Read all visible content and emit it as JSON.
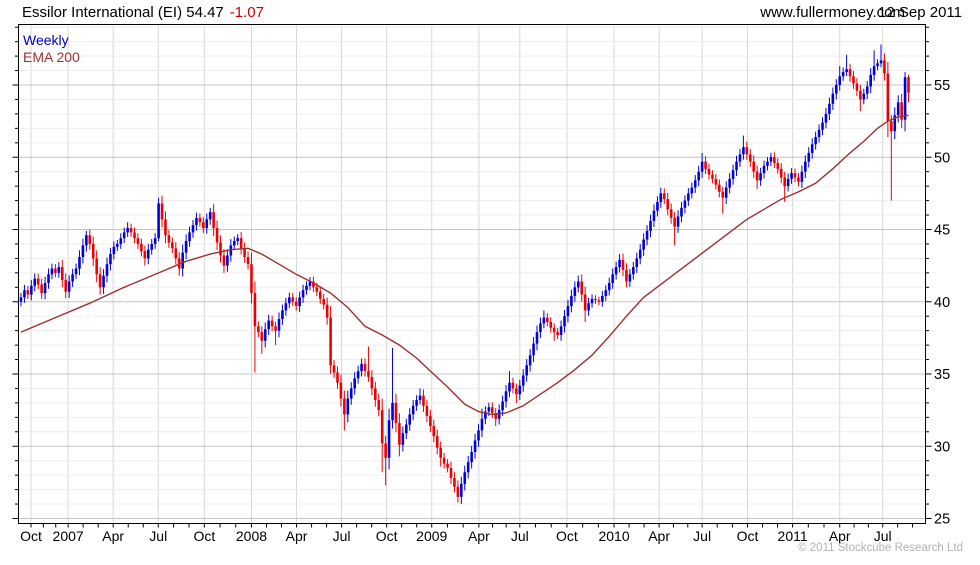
{
  "header": {
    "title_main": "Essilor International (EI) 54.47",
    "change": "-1.07",
    "site": "www.fullermoney.com",
    "date": "12 Sep 2011"
  },
  "legend": {
    "timeframe": "Weekly",
    "overlay": "EMA 200"
  },
  "footer": {
    "copyright": "© 2011 Stockcube Research Ltd"
  },
  "colors": {
    "up": "#0000dd",
    "down": "#ee0000",
    "ema": "#9c3030",
    "change_text": "#cc0000",
    "weekly_text": "#0000bb",
    "grid_minor": "#ededed",
    "grid_major": "#c4c4c4",
    "grid_vert": "#d6d6d6",
    "axis": "#000000",
    "copyright_text": "#b2b2b2"
  },
  "chart_data": {
    "type": "candlestick",
    "title": "Essilor International (EI)",
    "timeframe": "Weekly",
    "overlay": "EMA 200",
    "last_close": 54.47,
    "change": -1.07,
    "prev_close": 55.54,
    "ylim": [
      24.7,
      59.2
    ],
    "y_ticks": [
      25,
      30,
      35,
      40,
      45,
      50,
      55
    ],
    "y_minor_step": 1,
    "grid": true,
    "x_labels": [
      {
        "label": "Oct",
        "wk": 2.9
      },
      {
        "label": "2007",
        "wk": 13.7
      },
      {
        "label": "Apr",
        "wk": 26.8
      },
      {
        "label": "Jul",
        "wk": 39.9
      },
      {
        "label": "Oct",
        "wk": 53.3
      },
      {
        "label": "2008",
        "wk": 67.0
      },
      {
        "label": "Apr",
        "wk": 80.1
      },
      {
        "label": "Jul",
        "wk": 93.2
      },
      {
        "label": "Oct",
        "wk": 106.3
      },
      {
        "label": "2009",
        "wk": 119.4
      },
      {
        "label": "Apr",
        "wk": 133.1
      },
      {
        "label": "Jul",
        "wk": 145.0
      },
      {
        "label": "Oct",
        "wk": 158.7
      },
      {
        "label": "2010",
        "wk": 172.4
      },
      {
        "label": "Apr",
        "wk": 185.5
      },
      {
        "label": "Jul",
        "wk": 198.0
      },
      {
        "label": "Oct",
        "wk": 211.2
      },
      {
        "label": "2011",
        "wk": 224.3
      },
      {
        "label": "Apr",
        "wk": 238.0
      },
      {
        "label": "Jul",
        "wk": 250.5
      }
    ],
    "first_open": 40.0,
    "closes": [
      40.3,
      40.8,
      40.5,
      41.1,
      41.6,
      41.2,
      40.6,
      41.3,
      41.9,
      42.3,
      42.0,
      42.4,
      41.5,
      40.7,
      41.4,
      41.9,
      42.3,
      43.1,
      43.9,
      44.6,
      44.0,
      43.0,
      41.9,
      41.0,
      41.8,
      42.6,
      43.3,
      43.8,
      44.0,
      44.4,
      44.8,
      45.1,
      44.8,
      44.4,
      44.0,
      43.5,
      43.0,
      43.6,
      44.0,
      44.4,
      46.8,
      45.7,
      44.6,
      44.1,
      43.7,
      43.0,
      42.3,
      43.4,
      44.2,
      44.8,
      45.3,
      45.8,
      45.5,
      45.1,
      45.7,
      46.2,
      45.1,
      44.1,
      43.2,
      42.5,
      43.2,
      43.9,
      44.2,
      44.4,
      43.7,
      43.1,
      42.6,
      40.6,
      38.3,
      37.9,
      37.3,
      38.1,
      38.7,
      38.3,
      38.0,
      38.8,
      39.4,
      39.9,
      40.3,
      40.0,
      39.7,
      40.3,
      40.8,
      41.1,
      41.4,
      41.0,
      40.7,
      40.2,
      39.8,
      38.9,
      35.6,
      35.1,
      34.4,
      33.3,
      32.2,
      33.3,
      34.0,
      34.7,
      35.2,
      35.7,
      35.2,
      34.8,
      34.0,
      33.2,
      32.5,
      30.2,
      29.2,
      31.8,
      33.0,
      31.6,
      30.1,
      30.9,
      31.5,
      32.2,
      32.8,
      33.2,
      33.5,
      32.8,
      32.1,
      31.4,
      30.7,
      29.9,
      29.2,
      28.8,
      28.5,
      27.8,
      27.2,
      26.5,
      27.4,
      28.2,
      28.9,
      29.6,
      30.4,
      31.1,
      31.9,
      32.4,
      32.7,
      32.3,
      31.9,
      32.5,
      33.1,
      33.8,
      34.4,
      34.0,
      33.6,
      34.2,
      34.9,
      35.6,
      36.3,
      37.1,
      37.9,
      38.5,
      38.9,
      38.6,
      38.2,
      37.9,
      37.7,
      38.3,
      39.0,
      39.7,
      40.4,
      41.0,
      41.4,
      40.5,
      39.4,
      39.9,
      40.2,
      40.1,
      40.0,
      40.4,
      40.8,
      41.3,
      41.9,
      42.4,
      42.9,
      42.2,
      41.4,
      41.9,
      42.4,
      43.0,
      43.6,
      44.3,
      44.9,
      45.6,
      46.3,
      46.9,
      47.5,
      47.1,
      46.4,
      45.8,
      45.2,
      45.9,
      46.5,
      47.0,
      47.5,
      47.9,
      48.4,
      49.0,
      49.7,
      49.2,
      48.8,
      48.5,
      48.1,
      47.6,
      47.2,
      47.9,
      48.5,
      49.1,
      49.7,
      50.2,
      50.7,
      50.2,
      49.7,
      49.0,
      48.4,
      48.9,
      49.4,
      49.7,
      50.0,
      49.6,
      49.2,
      48.6,
      48.0,
      48.5,
      48.9,
      48.6,
      48.3,
      49.0,
      49.7,
      50.3,
      50.9,
      51.4,
      51.9,
      52.4,
      53.0,
      53.7,
      54.4,
      55.0,
      55.6,
      55.9,
      56.1,
      55.6,
      55.1,
      54.6,
      54.0,
      54.4,
      54.9,
      55.7,
      56.3,
      56.5,
      56.7,
      55.8,
      52.5,
      51.8,
      52.9,
      53.8,
      52.6,
      55.54,
      54.47
    ],
    "wick_overrides": {
      "19": {
        "h": 44.9
      },
      "23": {
        "l": 40.5
      },
      "31": {
        "h": 45.5
      },
      "36": {
        "l": 42.5
      },
      "40": {
        "h": 47.2,
        "l": 44.2
      },
      "46": {
        "l": 41.8
      },
      "55": {
        "h": 46.5
      },
      "59": {
        "l": 42.0
      },
      "67": {
        "l": 39.9
      },
      "68": {
        "l": 35.1
      },
      "70": {
        "l": 36.4
      },
      "74": {
        "l": 37.0
      },
      "84": {
        "h": 41.7
      },
      "90": {
        "l": 35.0
      },
      "94": {
        "l": 31.1
      },
      "101": {
        "h": 36.9
      },
      "105": {
        "l": 28.2
      },
      "106": {
        "l": 27.3
      },
      "108": {
        "h": 36.8
      },
      "110": {
        "l": 29.3
      },
      "116": {
        "h": 34.0
      },
      "122": {
        "l": 28.6
      },
      "127": {
        "l": 26.1
      },
      "134": {
        "h": 32.6
      },
      "138": {
        "l": 31.4
      },
      "142": {
        "h": 35.2
      },
      "144": {
        "l": 33.0
      },
      "152": {
        "h": 39.4
      },
      "155": {
        "l": 37.3
      },
      "162": {
        "h": 41.8
      },
      "164": {
        "l": 38.6
      },
      "174": {
        "h": 43.3
      },
      "176": {
        "l": 41.0
      },
      "186": {
        "h": 47.9
      },
      "190": {
        "l": 43.9
      },
      "198": {
        "h": 50.3
      },
      "204": {
        "l": 46.1
      },
      "210": {
        "h": 51.5
      },
      "214": {
        "l": 47.8
      },
      "222": {
        "l": 46.9
      },
      "238": {
        "h": 56.3
      },
      "240": {
        "h": 57.1
      },
      "244": {
        "l": 53.2
      },
      "248": {
        "h": 57.4
      },
      "250": {
        "h": 57.8
      },
      "252": {
        "l": 51.4
      },
      "253": {
        "l": 47.0
      },
      "257": {
        "h": 55.9
      },
      "258": {
        "h": 55.7,
        "l": 53.8
      }
    },
    "ema_points": [
      [
        0,
        37.9
      ],
      [
        10,
        38.9
      ],
      [
        20,
        39.9
      ],
      [
        30,
        41.0
      ],
      [
        40,
        42.0
      ],
      [
        48,
        42.8
      ],
      [
        55,
        43.3
      ],
      [
        61,
        43.6
      ],
      [
        66,
        43.7
      ],
      [
        70,
        43.3
      ],
      [
        75,
        42.6
      ],
      [
        80,
        41.9
      ],
      [
        85,
        41.3
      ],
      [
        90,
        40.6
      ],
      [
        95,
        39.6
      ],
      [
        100,
        38.3
      ],
      [
        105,
        37.7
      ],
      [
        110,
        37.0
      ],
      [
        115,
        36.1
      ],
      [
        119,
        35.2
      ],
      [
        124,
        34.1
      ],
      [
        129,
        32.9
      ],
      [
        133,
        32.4
      ],
      [
        137,
        32.2
      ],
      [
        141,
        32.3
      ],
      [
        146,
        32.8
      ],
      [
        151,
        33.6
      ],
      [
        156,
        34.4
      ],
      [
        161,
        35.3
      ],
      [
        166,
        36.3
      ],
      [
        171,
        37.6
      ],
      [
        176,
        39.0
      ],
      [
        181,
        40.3
      ],
      [
        186,
        41.2
      ],
      [
        191,
        42.1
      ],
      [
        196,
        43.0
      ],
      [
        201,
        43.9
      ],
      [
        206,
        44.8
      ],
      [
        211,
        45.7
      ],
      [
        216,
        46.4
      ],
      [
        221,
        47.1
      ],
      [
        226,
        47.6
      ],
      [
        231,
        48.2
      ],
      [
        236,
        49.2
      ],
      [
        241,
        50.3
      ],
      [
        245,
        51.1
      ],
      [
        249,
        52.0
      ],
      [
        252,
        52.5
      ],
      [
        255,
        52.8
      ],
      [
        258,
        52.9
      ]
    ]
  }
}
